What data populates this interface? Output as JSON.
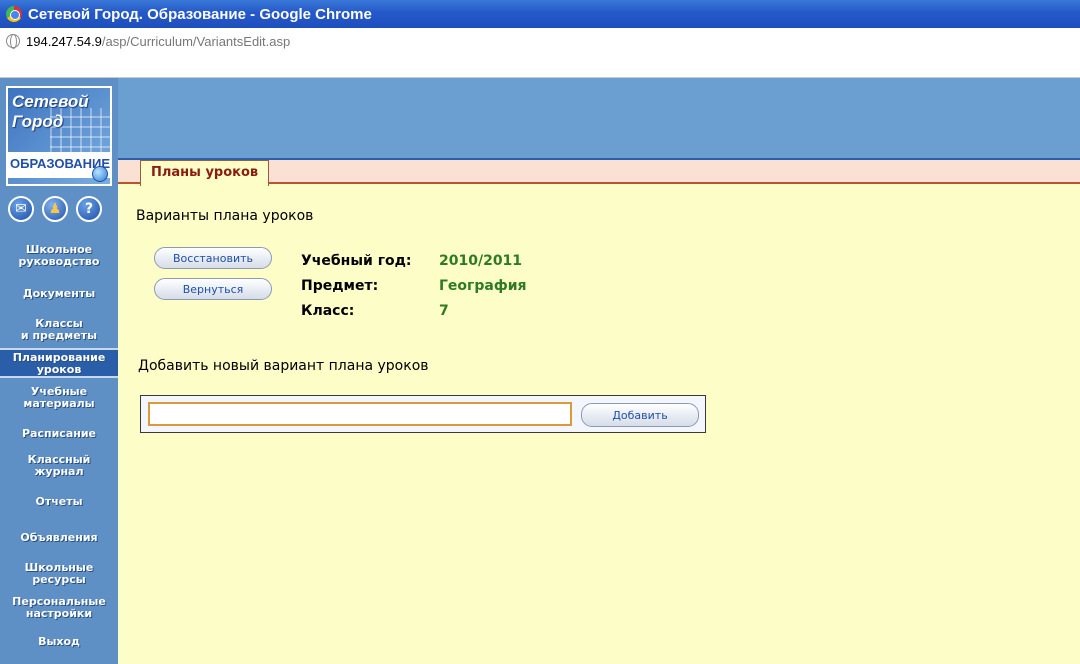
{
  "window": {
    "title": "Сетевой Город. Образование - Google Chrome",
    "url_host": "194.247.54.9",
    "url_path": "/asp/Curriculum/VariantsEdit.asp"
  },
  "logo": {
    "line1": "Сетевой",
    "line2": "Город",
    "line3": "ОБРАЗОВАНИЕ"
  },
  "sidebar": {
    "icons": [
      "mail-icon",
      "people-icon",
      "help-icon"
    ],
    "items": [
      {
        "line1": "Школьное",
        "line2": "руководство"
      },
      {
        "line1": "Документы",
        "line2": ""
      },
      {
        "line1": "Классы",
        "line2": "и предметы"
      },
      {
        "line1": "Планирование",
        "line2": "уроков"
      },
      {
        "line1": "Учебные",
        "line2": "материалы"
      },
      {
        "line1": "Расписание",
        "line2": ""
      },
      {
        "line1": "Классный",
        "line2": "журнал"
      },
      {
        "line1": "Отчеты",
        "line2": ""
      },
      {
        "line1": "Объявления",
        "line2": ""
      },
      {
        "line1": "Школьные",
        "line2": "ресурсы"
      },
      {
        "line1": "Персональные",
        "line2": "настройки"
      },
      {
        "line1": "Выход",
        "line2": ""
      }
    ]
  },
  "tabs": {
    "active": "Планы уроков"
  },
  "page": {
    "title": "Варианты плана уроков",
    "restore_label": "Восстановить",
    "return_label": "Вернуться",
    "year_label": "Учебный год:",
    "year_value": "2010/2011",
    "subject_label": "Предмет:",
    "subject_value": "География",
    "class_label": "Класс:",
    "class_value": "7",
    "add_section_title": "Добавить новый вариант плана уроков",
    "add_input_value": "",
    "add_label": "Добавить"
  },
  "colors": {
    "content_bg": "#fdfdc8",
    "sidebar_bg": "#5e8fc5",
    "value_green": "#2f7a22",
    "tab_text": "#8a1d12"
  }
}
